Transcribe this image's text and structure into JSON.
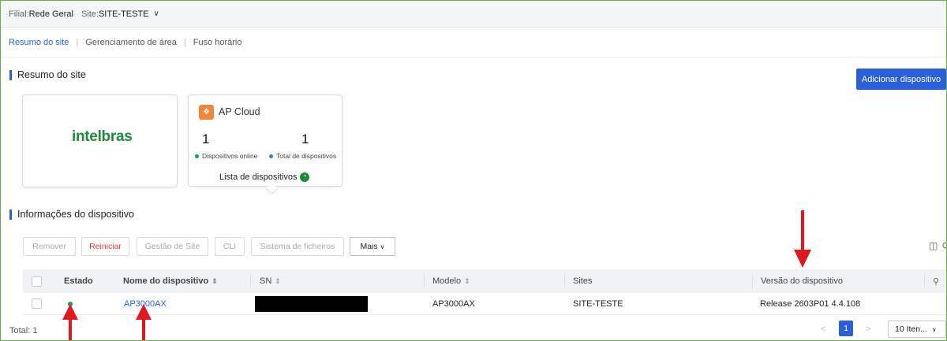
{
  "filter": {
    "branch_label": "Filial:",
    "branch_value": "Rede Geral",
    "site_label": "Site:",
    "site_value": "SITE-TESTE"
  },
  "tabs": [
    {
      "label": "Resumo do site"
    },
    {
      "label": "Gerenciamento de área"
    },
    {
      "label": "Fuso horário"
    }
  ],
  "summary": {
    "title": "Resumo do site",
    "add_button": "Adicionar dispositivo",
    "brand": "intelbras",
    "ap_card": {
      "title": "AP Cloud",
      "online_count": "1",
      "total_count": "1",
      "online_label": "Dispositivos online",
      "total_label": "Total de dispositivos",
      "list_link": "Lista de dispositivos"
    }
  },
  "devices": {
    "title": "Informações do dispositivo",
    "toolbar": {
      "remove": "Remover",
      "restart": "Reiniciar",
      "site_mgmt": "Gestão de Site",
      "cli": "CLI",
      "file_system": "Sistema de ficheiros",
      "more": "Mais"
    },
    "columns": {
      "state": "Estado",
      "name": "Nome do dispositivo",
      "sn": "SN",
      "model": "Modelo",
      "sites": "Sites",
      "version": "Versão do dispositivo"
    },
    "rows": [
      {
        "name": "AP3000AX",
        "model": "AP3000AX",
        "site": "SITE-TESTE",
        "version": "Release 2603P01 4.4.108"
      }
    ],
    "total": "Total: 1",
    "page": "1",
    "page_size": "10 Iten..."
  },
  "colors": {
    "primary": "#2b5fd9",
    "online": "#1f9d55",
    "annotation": "#e0191e",
    "brand": "#1f8a3a"
  }
}
